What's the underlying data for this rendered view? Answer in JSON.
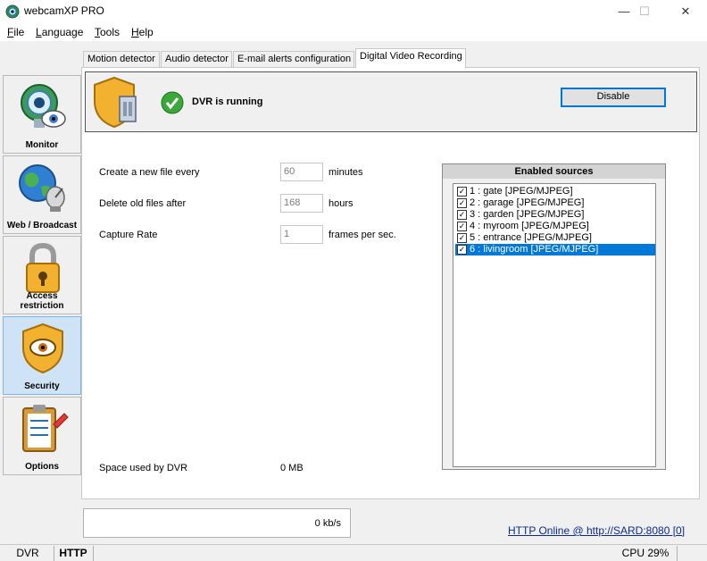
{
  "window": {
    "title": "webcamXP PRO",
    "minimize": "—",
    "maximize": "☐",
    "close": "✕"
  },
  "menu": [
    {
      "label": "File",
      "key": "F"
    },
    {
      "label": "Language",
      "key": "L"
    },
    {
      "label": "Tools",
      "key": "T"
    },
    {
      "label": "Help",
      "key": "H"
    }
  ],
  "sidebar": {
    "items": [
      {
        "label": "Monitor",
        "icon": "monitor-eye-icon"
      },
      {
        "label": "Web / Broadcast",
        "icon": "globe-satellite-icon"
      },
      {
        "label": "Access restriction",
        "icon": "padlock-icon"
      },
      {
        "label": "Security",
        "icon": "shield-eye-icon",
        "active": true
      },
      {
        "label": "Options",
        "icon": "clipboard-checklist-icon"
      }
    ]
  },
  "tabs": [
    {
      "label": "Motion detector"
    },
    {
      "label": "Audio detector"
    },
    {
      "label": "E-mail alerts configuration"
    },
    {
      "label": "Digital Video Recording",
      "active": true
    }
  ],
  "dvr": {
    "status": "DVR is running",
    "disable_label": "Disable",
    "settings": [
      {
        "label": "Create a new file every",
        "value": "60",
        "unit": "minutes"
      },
      {
        "label": "Delete old files after",
        "value": "168",
        "unit": "hours"
      },
      {
        "label": "Capture Rate",
        "value": "1",
        "unit": "frames per sec."
      }
    ],
    "space_label": "Space used by DVR",
    "space_value": "0 MB"
  },
  "sources": {
    "title": "Enabled sources",
    "items": [
      {
        "label": "1 : gate [JPEG/MJPEG]",
        "checked": true
      },
      {
        "label": "2 : garage [JPEG/MJPEG]",
        "checked": true
      },
      {
        "label": "3 : garden [JPEG/MJPEG]",
        "checked": true
      },
      {
        "label": "4 : myroom [JPEG/MJPEG]",
        "checked": true
      },
      {
        "label": "5 : entrance [JPEG/MJPEG]",
        "checked": true
      },
      {
        "label": "6 : livingroom [JPEG/MJPEG]",
        "checked": true,
        "selected": true
      }
    ]
  },
  "footer": {
    "bandwidth": "0 kb/s",
    "http_status": "HTTP Online @ http://SARD:8080 [0]"
  },
  "statusbar": {
    "dvr": "DVR",
    "http": "HTTP",
    "cpu": "CPU 29%"
  },
  "colors": {
    "selection": "#0078d7",
    "active_sidebar": "#cfe3f6",
    "link": "#0b2a8c"
  }
}
